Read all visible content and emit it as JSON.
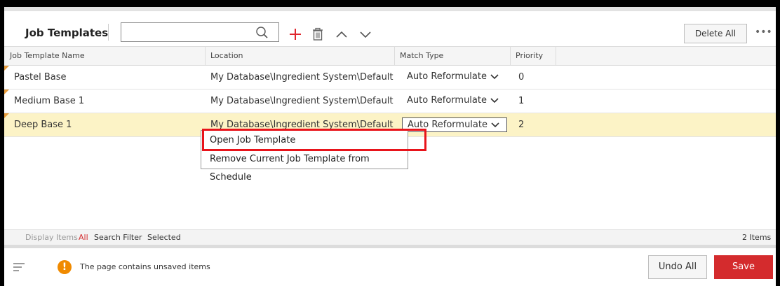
{
  "toolbar": {
    "title": "Job Templates",
    "search_value": "",
    "delete_all_label": "Delete All",
    "more_label": "•••",
    "icons": [
      "search-icon",
      "add-icon",
      "trash-icon",
      "chevron-up-icon",
      "chevron-down-icon"
    ],
    "add_color": "#e0262d"
  },
  "table": {
    "columns": [
      "Job Template Name",
      "Location",
      "Match Type",
      "Priority"
    ],
    "rows": [
      {
        "name": "Pastel Base",
        "location": "My Database\\Ingredient System\\Default",
        "match_type": "Auto Reformulate",
        "priority": "0"
      },
      {
        "name": "Medium Base 1",
        "location": "My Database\\Ingredient System\\Default",
        "match_type": "Auto Reformulate",
        "priority": "1"
      },
      {
        "name": "Deep Base 1",
        "location": "My Database\\Ingredient System\\Default",
        "match_type": "Auto Reformulate",
        "priority": "2"
      }
    ],
    "selected_row_color": "#fcf3c6"
  },
  "context_menu": {
    "items": [
      "Open Job Template",
      "Remove Current Job Template from Schedule"
    ],
    "highlight_color": "#e8141b"
  },
  "status": {
    "display_items": "Display Items",
    "all": "All",
    "search_filter": "Search Filter",
    "selected": "Selected",
    "count": "2 Items"
  },
  "footer": {
    "warning_icon": "!",
    "message": "The page contains unsaved items",
    "undo_label": "Undo All",
    "save_label": "Save",
    "save_color": "#d42b2d",
    "warning_color": "#f08a00"
  }
}
